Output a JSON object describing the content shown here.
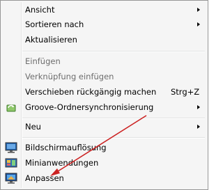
{
  "context_menu": {
    "items": [
      {
        "label": "Ansicht",
        "submenu": true,
        "disabled": false
      },
      {
        "label": "Sortieren nach",
        "submenu": true,
        "disabled": false
      },
      {
        "label": "Aktualisieren",
        "disabled": false
      },
      {
        "label": "Einfügen",
        "disabled": true
      },
      {
        "label": "Verknüpfung einfügen",
        "disabled": true
      },
      {
        "label": "Verschieben rückgängig machen",
        "shortcut": "Strg+Z",
        "disabled": false
      },
      {
        "label": "Groove-Ordnersynchronisierung",
        "submenu": true,
        "icon": "groove-sync-icon",
        "disabled": false
      },
      {
        "label": "Neu",
        "submenu": true,
        "disabled": false
      },
      {
        "label": "Bildschirmauflösung",
        "icon": "display-resolution-icon",
        "disabled": false
      },
      {
        "label": "Minianwendungen",
        "icon": "gadgets-icon",
        "disabled": false
      },
      {
        "label": "Anpassen",
        "icon": "personalize-icon",
        "disabled": false
      }
    ]
  },
  "colors": {
    "menu_background": "#f5f5f5",
    "menu_border": "#979797",
    "disabled_text": "#6d6d6d",
    "annotation_arrow": "#cc2222"
  }
}
